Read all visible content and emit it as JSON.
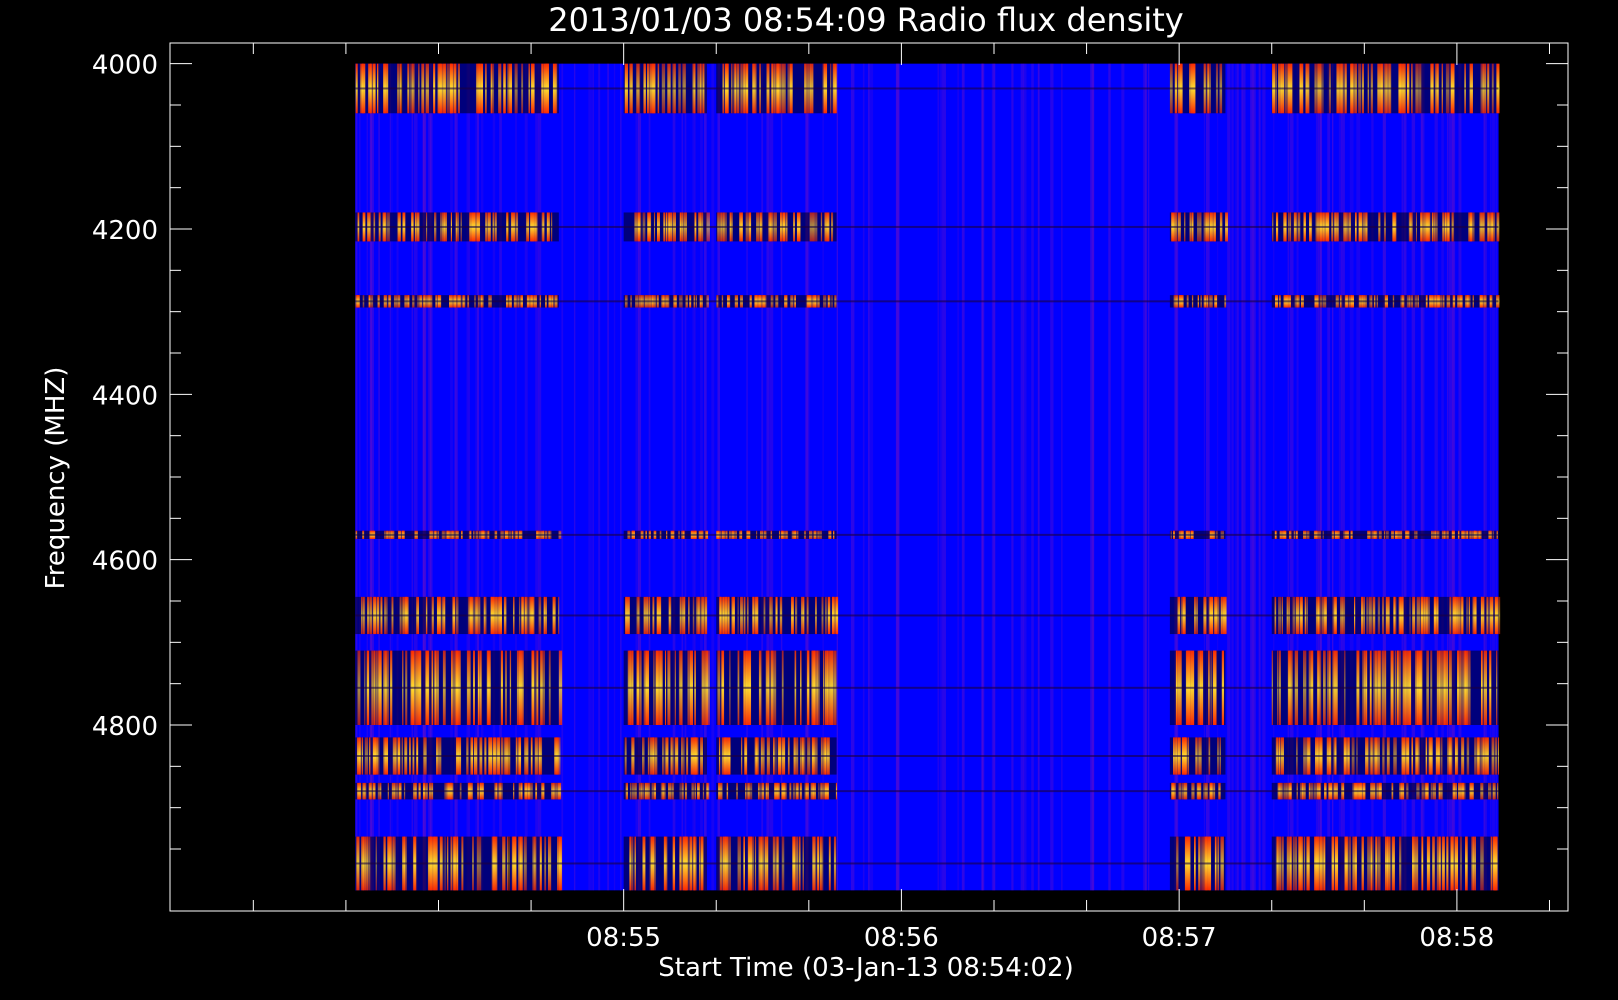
{
  "chart_data": {
    "type": "heatmap",
    "title": "2013/01/03 08:54:09 Radio flux density",
    "xlabel": "Start Time (03-Jan-13 08:54:02)",
    "ylabel": "Frequency (MHZ)",
    "x_start": "08:54:02",
    "x_end": "08:58:09",
    "xlim": [
      "08:53:22",
      "08:58:24"
    ],
    "ylim": [
      3975,
      5025
    ],
    "data_range": {
      "frequency_mhz": [
        4000,
        5000
      ]
    },
    "x_ticks": [
      "08:55",
      "08:56",
      "08:57",
      "08:58"
    ],
    "x_minor_ticks": [
      "08:53:40",
      "08:54:00",
      "08:54:20",
      "08:54:40",
      "08:55:20",
      "08:55:40",
      "08:56:20",
      "08:56:40",
      "08:57:20",
      "08:57:40",
      "08:58:20"
    ],
    "y_ticks": [
      4000,
      4200,
      4400,
      4600,
      4800
    ],
    "y_minor_ticks": [
      4050,
      4100,
      4150,
      4250,
      4300,
      4350,
      4450,
      4500,
      4550,
      4650,
      4700,
      4750,
      4850,
      4900,
      4950
    ],
    "colormap": {
      "low": "#0000ff",
      "mid": "#ff2a00",
      "high": "#ffe030",
      "dark": "#000010"
    },
    "bright_time_bands": [
      [
        "08:54:02",
        "08:54:12"
      ],
      [
        "08:54:12",
        "08:54:35"
      ],
      [
        "08:54:35",
        "08:54:46"
      ],
      [
        "08:55:00",
        "08:55:18"
      ],
      [
        "08:55:20",
        "08:55:46"
      ],
      [
        "08:56:58",
        "08:57:10"
      ],
      [
        "08:57:20",
        "08:58:09"
      ]
    ],
    "bright_frequency_bands_mhz": [
      [
        4000,
        4060
      ],
      [
        4180,
        4215
      ],
      [
        4280,
        4295
      ],
      [
        4565,
        4575
      ],
      [
        4645,
        4690
      ],
      [
        4710,
        4800
      ],
      [
        4815,
        4860
      ],
      [
        4870,
        4890
      ],
      [
        4935,
        5000
      ]
    ]
  }
}
